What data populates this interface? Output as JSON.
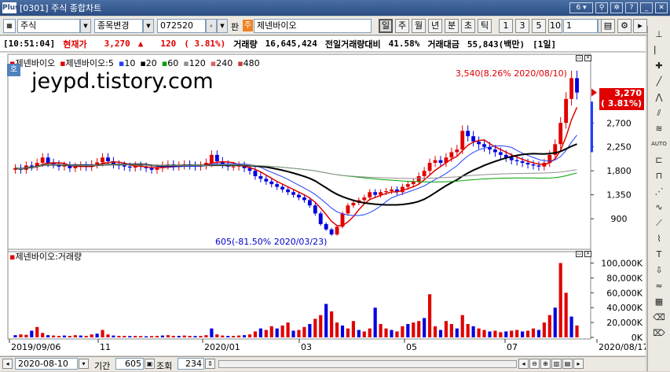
{
  "window": {
    "logo": "Plus",
    "title": "[0301] 주식 종합차트",
    "screen_number": "6"
  },
  "toolbar": {
    "market": "주식",
    "change_label": "종목변경",
    "code": "072520",
    "loan_label": "판",
    "stock_badge": "주",
    "stock_name": "제넨바이오",
    "periods": [
      "일",
      "주",
      "월",
      "년",
      "분",
      "초",
      "틱"
    ],
    "active_period": "일",
    "intervals": [
      "1",
      "3",
      "5",
      "10"
    ],
    "interval_value": "1"
  },
  "infobar": {
    "time": "[10:51:04]",
    "price_label": "현재가",
    "price": "3,270",
    "change_arrow": "▲",
    "change": "120",
    "change_pct": "( 3.81%)",
    "volume_label": "거래량",
    "volume": "16,645,424",
    "prev_ratio_label": "전일거래량대비",
    "prev_ratio": "41.58%",
    "amount_label": "거래대금",
    "amount": "55,843(백만)",
    "period": "[1일]"
  },
  "price_legend": {
    "items": [
      {
        "text": "제넨바이오",
        "color": "#e00000"
      },
      {
        "text": "제넨바이오:5",
        "color": "#e00000"
      },
      {
        "text": "10",
        "color": "#2040ff"
      },
      {
        "text": "20",
        "color": "#000000"
      },
      {
        "text": "60",
        "color": "#00a000"
      },
      {
        "text": "120",
        "color": "#909090"
      },
      {
        "text": "240",
        "color": "#e06060"
      },
      {
        "text": "480",
        "color": "#c04040"
      }
    ]
  },
  "volume_legend": "제넨바이오:거래량",
  "watermark": "jeypd.tistory.com",
  "ho_badge": "호",
  "annotations": {
    "high": "3,540(8.26% 2020/08/10)",
    "low": "605(-81.50% 2020/03/23)"
  },
  "current_price_box": {
    "price": "3,270",
    "pct": "( 3.81%)"
  },
  "chart_data": [
    {
      "type": "candlestick",
      "title": "제넨바이오",
      "y_ticks": [
        "2,700",
        "2,250",
        "1,800",
        "1,350",
        "900"
      ],
      "x_ticks": [
        "2019/09/06",
        "11",
        "2020/01",
        "03",
        "05",
        "07",
        "2020/08/17"
      ],
      "closes": [
        1850,
        1820,
        1900,
        1880,
        1950,
        2050,
        1950,
        1920,
        1880,
        1900,
        1850,
        1880,
        1900,
        1870,
        1920,
        1960,
        2050,
        1980,
        1920,
        1900,
        1880,
        1860,
        1900,
        1880,
        1850,
        1820,
        1850,
        1900,
        1920,
        1880,
        1900,
        1920,
        1900,
        1880,
        1900,
        1950,
        2100,
        1980,
        1920,
        1880,
        1880,
        1900,
        1850,
        1800,
        1700,
        1650,
        1600,
        1550,
        1500,
        1450,
        1400,
        1350,
        1300,
        1250,
        1150,
        1000,
        800,
        700,
        605,
        750,
        1000,
        1150,
        1200,
        1250,
        1300,
        1400,
        1350,
        1400,
        1420,
        1450,
        1400,
        1500,
        1550,
        1600,
        1700,
        1800,
        1950,
        2000,
        1950,
        2050,
        2150,
        2200,
        2550,
        2450,
        2350,
        2300,
        2250,
        2200,
        2150,
        2100,
        2050,
        2000,
        1980,
        1950,
        1920,
        1900,
        1880,
        1950,
        2100,
        2300,
        2700,
        3150,
        3540,
        3270
      ],
      "high": 3540,
      "low": 605,
      "current": 3270
    },
    {
      "type": "bar",
      "title": "제넨바이오:거래량",
      "y_ticks": [
        "100,000K",
        "80,000K",
        "60,000K",
        "40,000K",
        "20,000K",
        "0K"
      ],
      "ylim": [
        0,
        110000
      ],
      "values": [
        3000,
        4000,
        3500,
        9000,
        14000,
        6000,
        3000,
        2500,
        2000,
        2500,
        2000,
        3000,
        2500,
        2000,
        4000,
        5000,
        10000,
        4000,
        2500,
        2000,
        2000,
        1800,
        2000,
        1800,
        1500,
        1800,
        2000,
        2500,
        3000,
        2000,
        2000,
        2500,
        2000,
        1800,
        2000,
        3000,
        12000,
        4000,
        2500,
        2000,
        2000,
        2500,
        3000,
        4000,
        8000,
        12000,
        10000,
        15000,
        12000,
        16000,
        20000,
        9000,
        10000,
        14000,
        18000,
        25000,
        30000,
        45000,
        35000,
        20000,
        16000,
        12000,
        22000,
        10000,
        8000,
        12000,
        40000,
        18000,
        12000,
        10000,
        8000,
        15000,
        18000,
        20000,
        22000,
        26000,
        58000,
        15000,
        10000,
        22000,
        18000,
        12000,
        30000,
        18000,
        15000,
        12000,
        10000,
        8000,
        9000,
        7000,
        8000,
        9000,
        10000,
        8000,
        9000,
        12000,
        10000,
        20000,
        30000,
        40000,
        100000,
        60000,
        28000,
        16000
      ]
    }
  ]
}
